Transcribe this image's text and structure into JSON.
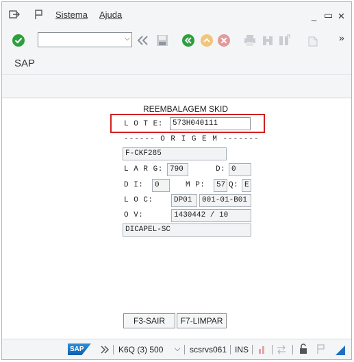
{
  "menubar": {
    "items": [
      "Sistema",
      "Ajuda"
    ],
    "controls": {
      "minimize": "_",
      "maximize": "▭",
      "close": "✕"
    }
  },
  "toolbar": {
    "command_value": "",
    "more": "»"
  },
  "title": "SAP",
  "screen": {
    "heading": "REEMBALAGEM SKID",
    "lote_label": "L O T E:",
    "lote_value": "573H040111",
    "origem_label": "------ O R I G E M -------",
    "material": "F-CKF285",
    "larg_label": "L A R G:",
    "larg_value": "790",
    "d_label": "D:",
    "d_value": "0",
    "di_label": "D I:",
    "di_value": "0",
    "mp_label": "M P:",
    "mp_value": "57",
    "q_label": "Q:",
    "q_value": "E",
    "loc_label": "L O C:",
    "loc_plant": "DP01",
    "loc_bin": "001-01-B01",
    "ov_label": "O V:",
    "ov_value": "1430442 / 10",
    "customer": "DICAPEL-SC"
  },
  "buttons": {
    "exit": "F3-SAIR",
    "clear": "F7-LIMPAR"
  },
  "statusbar": {
    "logo": "SAP",
    "system": "K6Q (3) 500",
    "server": "scsrvs061",
    "mode": "INS"
  },
  "colors": {
    "accent_green": "#2e9e3e",
    "highlight_red": "#d02020",
    "background": "#f4f5f6"
  }
}
